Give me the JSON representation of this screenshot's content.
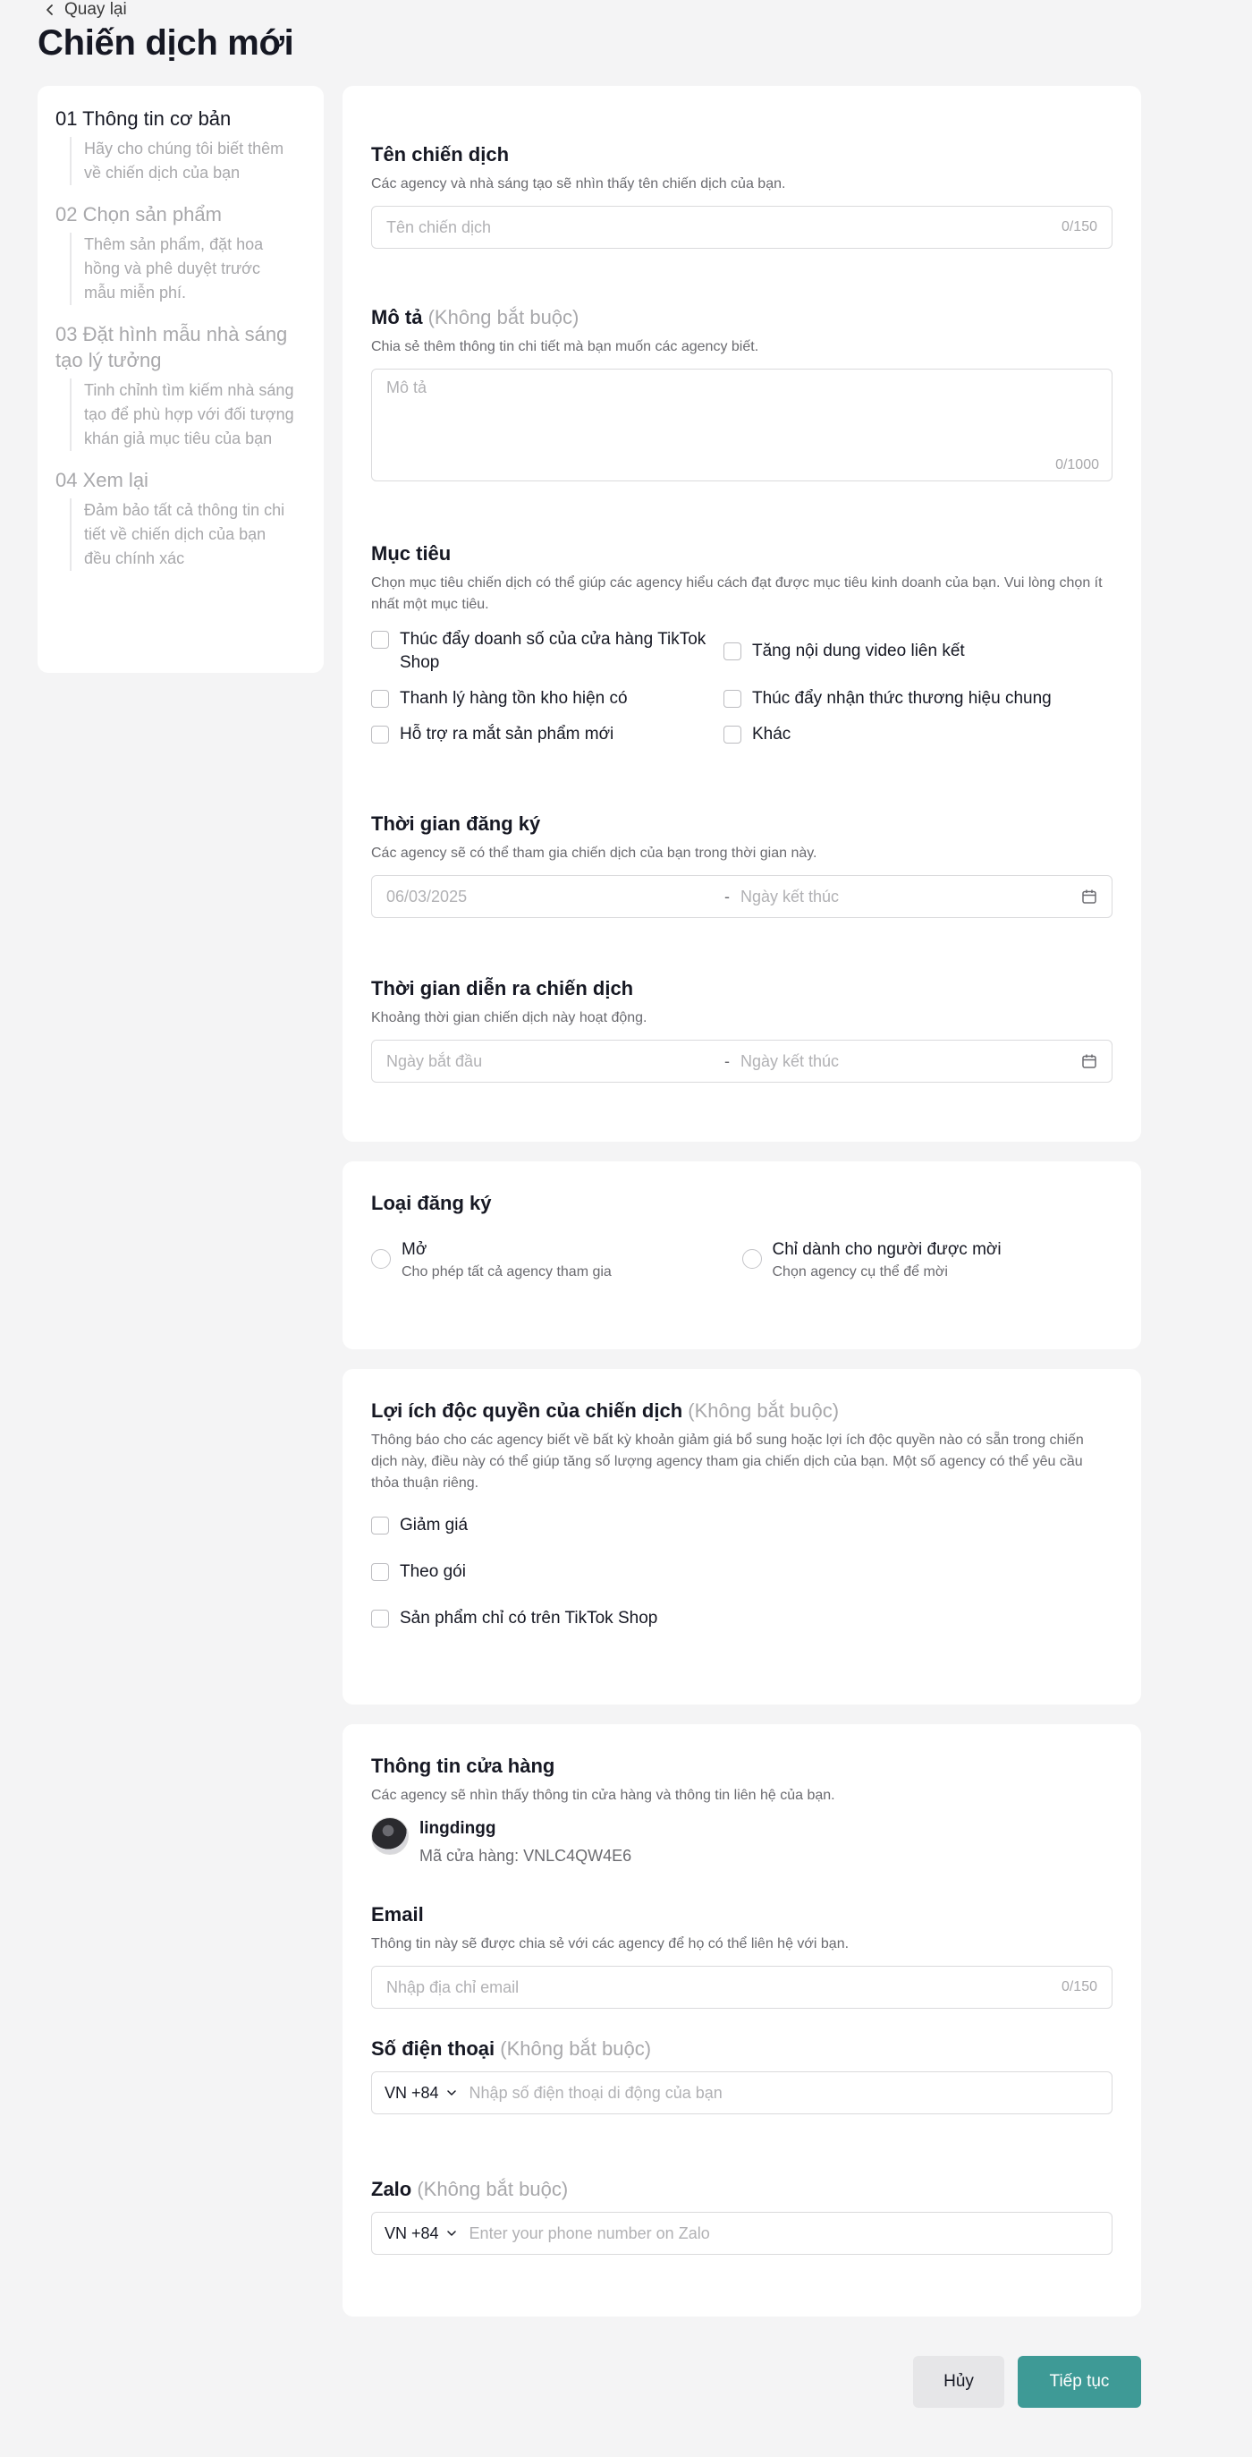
{
  "nav": {
    "back_label": "Quay lại"
  },
  "page": {
    "title": "Chiến dịch mới"
  },
  "steps": [
    {
      "title": "01 Thông tin cơ bản",
      "desc": "Hãy cho chúng tôi biết thêm về chiến dịch của bạn"
    },
    {
      "title": "02 Chọn sản phẩm",
      "desc": "Thêm sản phẩm, đặt hoa hồng và phê duyệt trước mẫu miễn phí."
    },
    {
      "title": "03 Đặt hình mẫu nhà sáng tạo lý tưởng",
      "desc": "Tinh chỉnh tìm kiếm nhà sáng tạo để phù hợp với đối tượng khán giả mục tiêu của bạn"
    },
    {
      "title": "04 Xem lại",
      "desc": "Đảm bảo tất cả thông tin chi tiết về chiến dịch của bạn đều chính xác"
    }
  ],
  "campaign_name": {
    "label": "Tên chiến dịch",
    "help": "Các agency và nhà sáng tạo sẽ nhìn thấy tên chiến dịch của bạn.",
    "placeholder": "Tên chiến dịch",
    "count": "0/150"
  },
  "description": {
    "label": "Mô tả",
    "optional": "(Không bắt buộc)",
    "help": "Chia sẻ thêm thông tin chi tiết mà bạn muốn các agency biết.",
    "placeholder": "Mô tả",
    "count": "0/1000"
  },
  "goals": {
    "label": "Mục tiêu",
    "help": "Chọn mục tiêu chiến dịch có thể giúp các agency hiểu cách đạt được mục tiêu kinh doanh của bạn. Vui lòng chọn ít nhất một mục tiêu.",
    "options": [
      "Thúc đẩy doanh số của cửa hàng TikTok Shop",
      "Tăng nội dung video liên kết",
      "Thanh lý hàng tồn kho hiện có",
      "Thúc đẩy nhận thức thương hiệu chung",
      "Hỗ trợ ra mắt sản phẩm mới",
      "Khác"
    ]
  },
  "registration_period": {
    "label": "Thời gian đăng ký",
    "help": "Các agency sẽ có thể tham gia chiến dịch của bạn trong thời gian này.",
    "start": "06/03/2025",
    "separator": "-",
    "end": "Ngày kết thúc"
  },
  "campaign_period": {
    "label": "Thời gian diễn ra chiến dịch",
    "help": "Khoảng thời gian chiến dịch này hoạt động.",
    "start": "Ngày bắt đầu",
    "separator": "-",
    "end": "Ngày kết thúc"
  },
  "registration_type": {
    "label": "Loại đăng ký",
    "options": [
      {
        "title": "Mở",
        "sub": "Cho phép tất cả agency tham gia"
      },
      {
        "title": "Chỉ dành cho người được mời",
        "sub": "Chọn agency cụ thể để mời"
      }
    ]
  },
  "benefits": {
    "label": "Lợi ích độc quyền của chiến dịch",
    "optional": "(Không bắt buộc)",
    "help": "Thông báo cho các agency biết về bất kỳ khoản giảm giá bổ sung hoặc lợi ích độc quyền nào có sẵn trong chiến dịch này, điều này có thể giúp tăng số lượng agency tham gia chiến dịch của bạn. Một số agency có thể yêu cầu thỏa thuận riêng.",
    "options": [
      "Giảm giá",
      "Theo gói",
      "Sản phẩm chỉ có trên TikTok Shop"
    ]
  },
  "store": {
    "label": "Thông tin cửa hàng",
    "help": "Các agency sẽ nhìn thấy thông tin cửa hàng và thông tin liên hệ của bạn.",
    "name": "lingdingg",
    "code": "Mã cửa hàng: VNLC4QW4E6"
  },
  "email": {
    "label": "Email",
    "help": "Thông tin này sẽ được chia sẻ với các agency để họ có thể liên hệ với bạn.",
    "placeholder": "Nhập địa chỉ email",
    "count": "0/150"
  },
  "phone": {
    "label": "Số điện thoại",
    "optional": "(Không bắt buộc)",
    "country": "VN +84",
    "placeholder": "Nhập số điện thoại di động của bạn"
  },
  "zalo": {
    "label": "Zalo",
    "optional": "(Không bắt buộc)",
    "country": "VN +84",
    "placeholder": "Enter your phone number on Zalo"
  },
  "actions": {
    "cancel": "Hủy",
    "next": "Tiếp tục"
  },
  "colors": {
    "primary": "#3e9a96",
    "text": "#161823",
    "muted": "#a8a8ab",
    "background": "#f4f4f5"
  }
}
